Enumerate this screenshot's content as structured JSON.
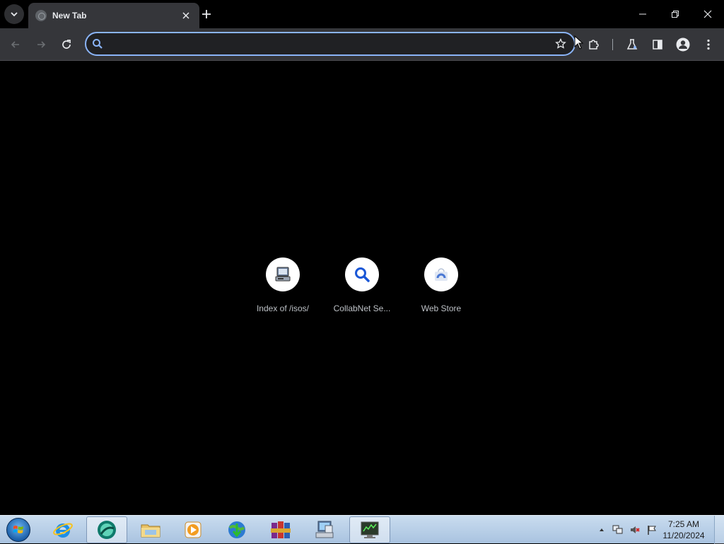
{
  "browser": {
    "tab": {
      "title": "New Tab"
    },
    "omnibox": {
      "value": "",
      "placeholder": ""
    }
  },
  "shortcuts": [
    {
      "label": "Index of /isos/",
      "icon": "server-computer-icon"
    },
    {
      "label": "CollabNet Se...",
      "icon": "search-icon"
    },
    {
      "label": "Web Store",
      "icon": "web-store-icon"
    }
  ],
  "taskbar": {
    "apps": [
      {
        "name": "internet-explorer",
        "active": false
      },
      {
        "name": "chrome-browser",
        "active": true
      },
      {
        "name": "file-explorer",
        "active": false
      },
      {
        "name": "media-player",
        "active": false
      },
      {
        "name": "download-manager",
        "active": false
      },
      {
        "name": "winrar",
        "active": false
      },
      {
        "name": "network-computer",
        "active": false
      },
      {
        "name": "system-monitor",
        "active": false
      }
    ],
    "clock": {
      "time": "7:25 AM",
      "date": "11/20/2024"
    }
  },
  "colors": {
    "accent": "#8ab4f8",
    "toolbar_bg": "#35363a",
    "page_bg": "#000000",
    "taskbar_bg": "#b9d1ea"
  }
}
